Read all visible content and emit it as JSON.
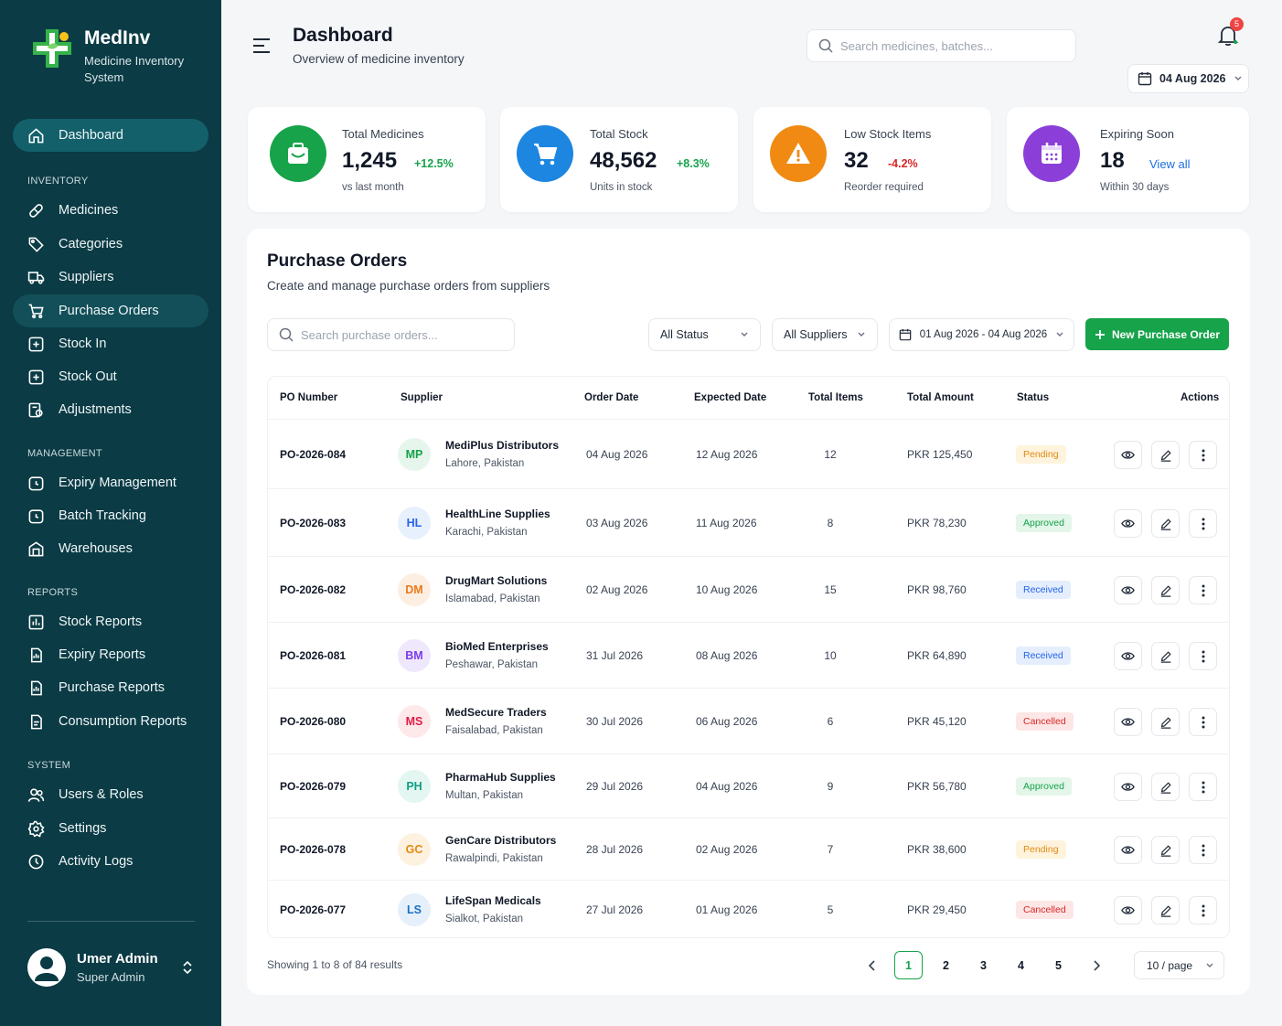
{
  "brand": {
    "name": "MedInv",
    "tagline": "Medicine Inventory System"
  },
  "sidebar": {
    "dashboard": "Dashboard",
    "sections": {
      "inventory": "INVENTORY",
      "management": "MANAGEMENT",
      "reports": "REPORTS",
      "system": "SYSTEM"
    },
    "inventory_items": [
      "Medicines",
      "Categories",
      "Suppliers",
      "Purchase Orders",
      "Stock In",
      "Stock Out",
      "Adjustments"
    ],
    "management_items": [
      "Expiry Management",
      "Batch Tracking",
      "Warehouses"
    ],
    "report_items": [
      "Stock Reports",
      "Expiry Reports",
      "Purchase Reports",
      "Consumption Reports"
    ],
    "system_items": [
      "Users & Roles",
      "Settings",
      "Activity Logs"
    ]
  },
  "user": {
    "name": "Umer Admin",
    "role": "Super Admin"
  },
  "header": {
    "title": "Dashboard",
    "subtitle": "Overview of medicine inventory",
    "search_placeholder": "Search medicines, batches...",
    "notification_count": "5",
    "date": "04 Aug 2026"
  },
  "stats": [
    {
      "label": "Total Medicines",
      "value": "1,245",
      "delta": "+12.5%",
      "note": "vs last month",
      "color": "#16a34a"
    },
    {
      "label": "Total Stock",
      "value": "48,562",
      "delta": "+8.3%",
      "note": "Units in stock",
      "color": "#1d86e0"
    },
    {
      "label": "Low Stock Items",
      "value": "32",
      "delta": "-4.2%",
      "note": "Reorder required",
      "color": "#f08a12"
    },
    {
      "label": "Expiring Soon",
      "value": "18",
      "delta": "View all",
      "note": "Within 30 days",
      "color": "#8b3fd8"
    }
  ],
  "purchase_orders": {
    "title": "Purchase Orders",
    "subtitle": "Create and manage purchase orders from suppliers",
    "search_placeholder": "Search purchase orders...",
    "status_filter": "All Status",
    "supplier_filter": "All Suppliers",
    "date_range": "01 Aug 2026 - 04 Aug 2026",
    "new_button": "New Purchase Order",
    "columns": [
      "PO Number",
      "Supplier",
      "Order Date",
      "Expected Date",
      "Total Items",
      "Total Amount",
      "Status",
      "Actions"
    ],
    "rows": [
      {
        "po": "PO-2026-084",
        "initials": "MP",
        "supplier": "MediPlus Distributors",
        "city": "Lahore, Pakistan",
        "order_date": "04 Aug 2026",
        "expected": "12 Aug 2026",
        "items": "12",
        "amount": "PKR 125,450",
        "status": "Pending"
      },
      {
        "po": "PO-2026-083",
        "initials": "HL",
        "supplier": "HealthLine Supplies",
        "city": "Karachi, Pakistan",
        "order_date": "03 Aug 2026",
        "expected": "11 Aug 2026",
        "items": "8",
        "amount": "PKR 78,230",
        "status": "Approved"
      },
      {
        "po": "PO-2026-082",
        "initials": "DM",
        "supplier": "DrugMart Solutions",
        "city": "Islamabad, Pakistan",
        "order_date": "02 Aug 2026",
        "expected": "10 Aug 2026",
        "items": "15",
        "amount": "PKR 98,760",
        "status": "Received"
      },
      {
        "po": "PO-2026-081",
        "initials": "BM",
        "supplier": "BioMed Enterprises",
        "city": "Peshawar, Pakistan",
        "order_date": "31 Jul 2026",
        "expected": "08 Aug 2026",
        "items": "10",
        "amount": "PKR 64,890",
        "status": "Received"
      },
      {
        "po": "PO-2026-080",
        "initials": "MS",
        "supplier": "MedSecure Traders",
        "city": "Faisalabad, Pakistan",
        "order_date": "30 Jul 2026",
        "expected": "06 Aug 2026",
        "items": "6",
        "amount": "PKR 45,120",
        "status": "Cancelled"
      },
      {
        "po": "PO-2026-079",
        "initials": "PH",
        "supplier": "PharmaHub Supplies",
        "city": "Multan, Pakistan",
        "order_date": "29 Jul 2026",
        "expected": "04 Aug 2026",
        "items": "9",
        "amount": "PKR 56,780",
        "status": "Approved"
      },
      {
        "po": "PO-2026-078",
        "initials": "GC",
        "supplier": "GenCare Distributors",
        "city": "Rawalpindi, Pakistan",
        "order_date": "28 Jul 2026",
        "expected": "02 Aug 2026",
        "items": "7",
        "amount": "PKR 38,600",
        "status": "Pending"
      },
      {
        "po": "PO-2026-077",
        "initials": "LS",
        "supplier": "LifeSpan Medicals",
        "city": "Sialkot, Pakistan",
        "order_date": "27 Jul 2026",
        "expected": "01 Aug 2026",
        "items": "5",
        "amount": "PKR 29,450",
        "status": "Cancelled"
      }
    ],
    "footer": "Showing 1 to 8 of 84 results",
    "pages": [
      "1",
      "2",
      "3",
      "4",
      "5"
    ],
    "per_page": "10 / page"
  },
  "colors": {
    "sidebar_bg": "#0b3b45",
    "accent": "#16a34a",
    "pending": "#f59e0b",
    "approved": "#16a34a",
    "received": "#2563eb",
    "cancelled": "#dc2626"
  }
}
